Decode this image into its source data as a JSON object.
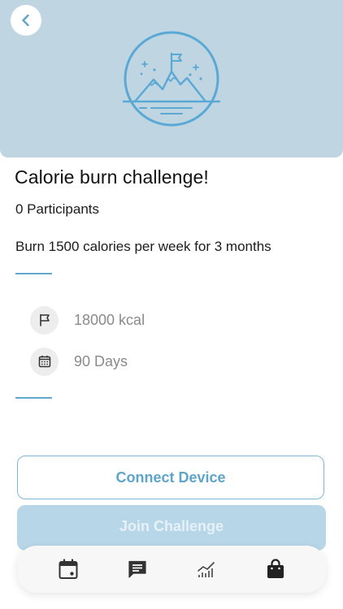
{
  "header": {
    "back_icon": "chevron-left-icon",
    "emblem_icon": "mountain-flag-icon"
  },
  "challenge": {
    "title": "Calorie burn challenge!",
    "participants": "0 Participants",
    "description": "Burn 1500 calories per week for 3 months",
    "goal": "18000 kcal",
    "duration": "90 Days"
  },
  "actions": {
    "connect_label": "Connect Device",
    "join_label": "Join Challenge"
  },
  "tabbar": {
    "items": [
      {
        "icon": "calendar-icon"
      },
      {
        "icon": "chat-icon"
      },
      {
        "icon": "chart-icon"
      },
      {
        "icon": "shopping-bag-icon"
      }
    ]
  },
  "colors": {
    "hero_background": "#bfd5e2",
    "accent": "#5ea5ca",
    "join_button": "#b7d6e8",
    "muted_text": "#8a8a8a"
  }
}
